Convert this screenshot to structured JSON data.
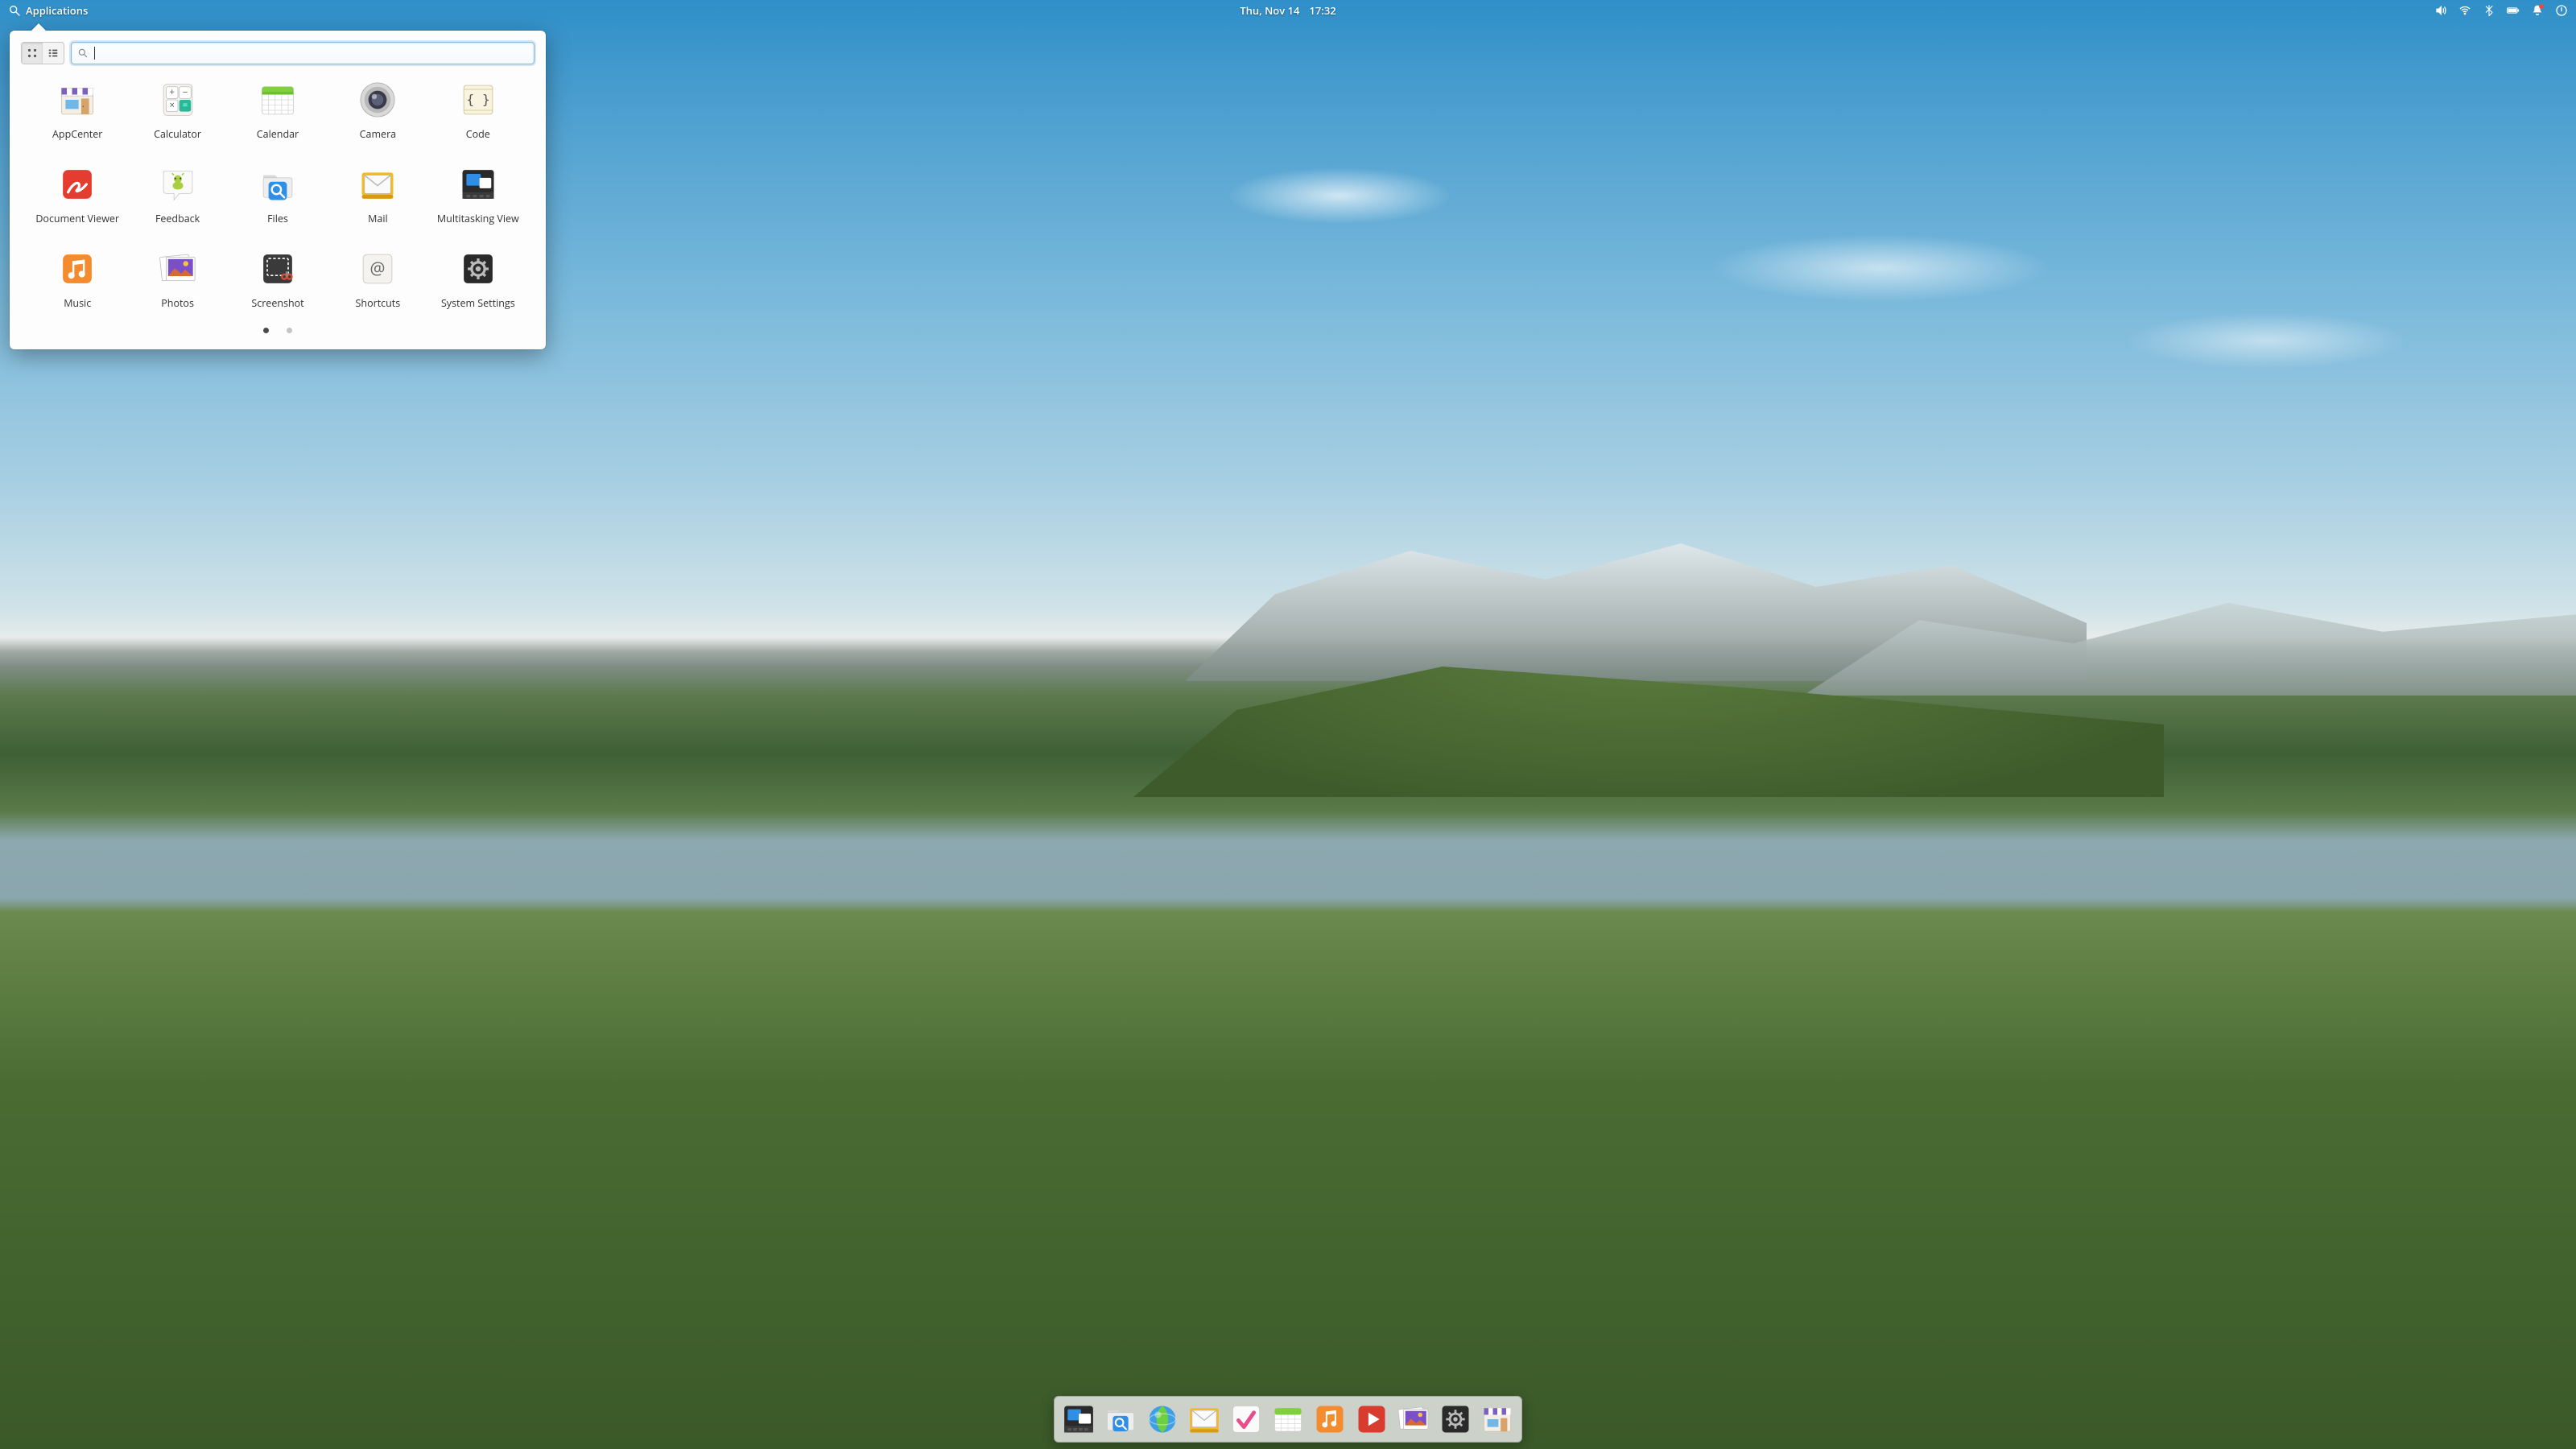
{
  "panel": {
    "applications_label": "Applications",
    "date": "Thu, Nov 14",
    "time": "17:32",
    "indicators": [
      "sound",
      "network",
      "bluetooth",
      "battery",
      "notifications",
      "session"
    ]
  },
  "menu": {
    "view_mode": "grid",
    "search_value": "",
    "search_placeholder": "",
    "apps": [
      {
        "id": "appcenter",
        "label": "AppCenter"
      },
      {
        "id": "calculator",
        "label": "Calculator"
      },
      {
        "id": "calendar",
        "label": "Calendar"
      },
      {
        "id": "camera",
        "label": "Camera"
      },
      {
        "id": "code",
        "label": "Code"
      },
      {
        "id": "document-viewer",
        "label": "Document Viewer"
      },
      {
        "id": "feedback",
        "label": "Feedback"
      },
      {
        "id": "files",
        "label": "Files"
      },
      {
        "id": "mail",
        "label": "Mail"
      },
      {
        "id": "multitasking",
        "label": "Multitasking View"
      },
      {
        "id": "music",
        "label": "Music"
      },
      {
        "id": "photos",
        "label": "Photos"
      },
      {
        "id": "screenshot",
        "label": "Screenshot"
      },
      {
        "id": "shortcuts",
        "label": "Shortcuts"
      },
      {
        "id": "system-settings",
        "label": "System Settings"
      }
    ],
    "page_count": 2,
    "current_page": 1
  },
  "dock": {
    "items": [
      {
        "id": "multitasking",
        "label": "Multitasking View"
      },
      {
        "id": "files",
        "label": "Files"
      },
      {
        "id": "web",
        "label": "Web"
      },
      {
        "id": "mail",
        "label": "Mail"
      },
      {
        "id": "tasks",
        "label": "Tasks"
      },
      {
        "id": "calendar",
        "label": "Calendar"
      },
      {
        "id": "music",
        "label": "Music"
      },
      {
        "id": "videos",
        "label": "Videos"
      },
      {
        "id": "photos",
        "label": "Photos"
      },
      {
        "id": "system-settings",
        "label": "System Settings"
      },
      {
        "id": "appcenter",
        "label": "AppCenter"
      }
    ]
  }
}
